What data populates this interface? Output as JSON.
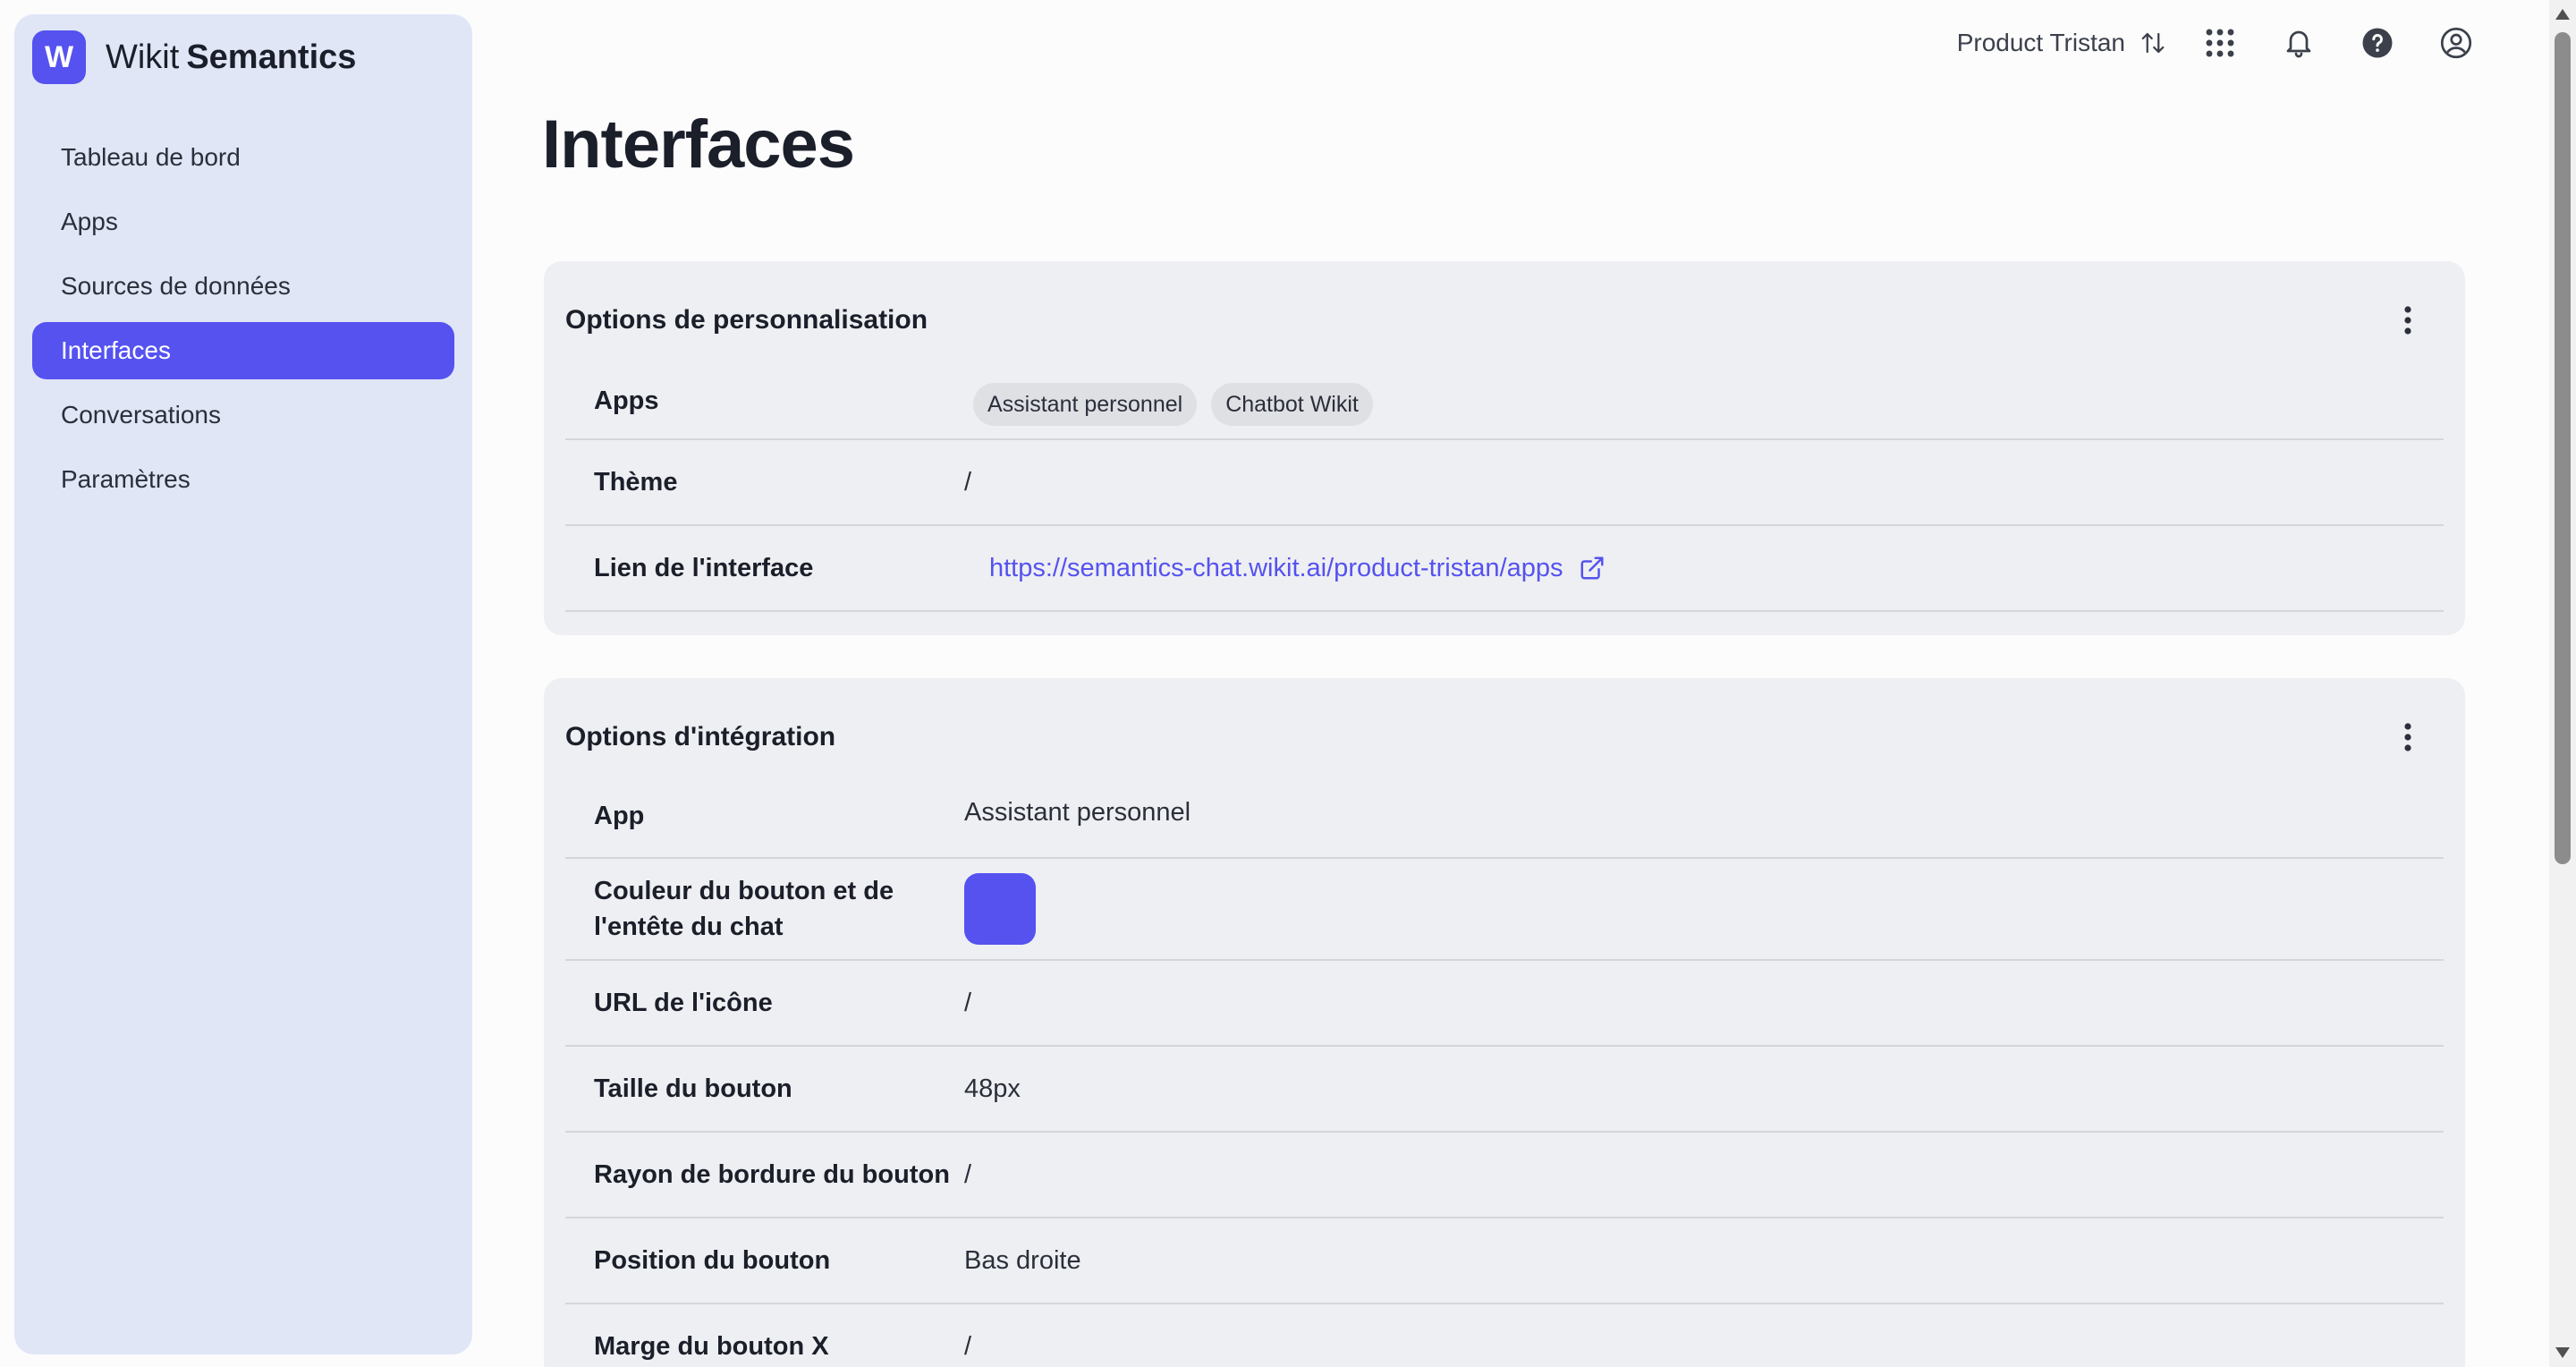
{
  "brand": {
    "logo_letter": "W",
    "name_part1": "Wikit",
    "name_part2": "Semantics",
    "accent": "#5552f0"
  },
  "sidebar": {
    "items": [
      {
        "label": "Tableau de bord",
        "active": false
      },
      {
        "label": "Apps",
        "active": false
      },
      {
        "label": "Sources de données",
        "active": false
      },
      {
        "label": "Interfaces",
        "active": true
      },
      {
        "label": "Conversations",
        "active": false
      },
      {
        "label": "Paramètres",
        "active": false
      }
    ]
  },
  "topbar": {
    "org_name": "Product Tristan",
    "icons": [
      "switch-arrows-icon",
      "apps-grid-icon",
      "bell-icon",
      "help-icon",
      "account-icon"
    ]
  },
  "page": {
    "title": "Interfaces"
  },
  "personalization": {
    "title": "Options de personnalisation",
    "apps_label": "Apps",
    "apps": [
      "Assistant personnel",
      "Chatbot Wikit"
    ],
    "theme_label": "Thème",
    "theme_value": "/",
    "link_label": "Lien de l'interface",
    "link_value": "https://semantics-chat.wikit.ai/product-tristan/apps"
  },
  "integration": {
    "title": "Options d'intégration",
    "app_label": "App",
    "app_value": "Assistant personnel",
    "color_label_line1": "Couleur du bouton et de",
    "color_label_line2": "l'entête du chat",
    "color_value": "#5552f0",
    "icon_url_label": "URL de l'icône",
    "icon_url_value": "/",
    "size_label": "Taille du bouton",
    "size_value": "48px",
    "radius_label": "Rayon de bordure du bouton",
    "radius_value": "/",
    "position_label": "Position du bouton",
    "position_value": "Bas droite",
    "margin_x_label": "Marge du bouton X",
    "margin_x_value": "/"
  }
}
